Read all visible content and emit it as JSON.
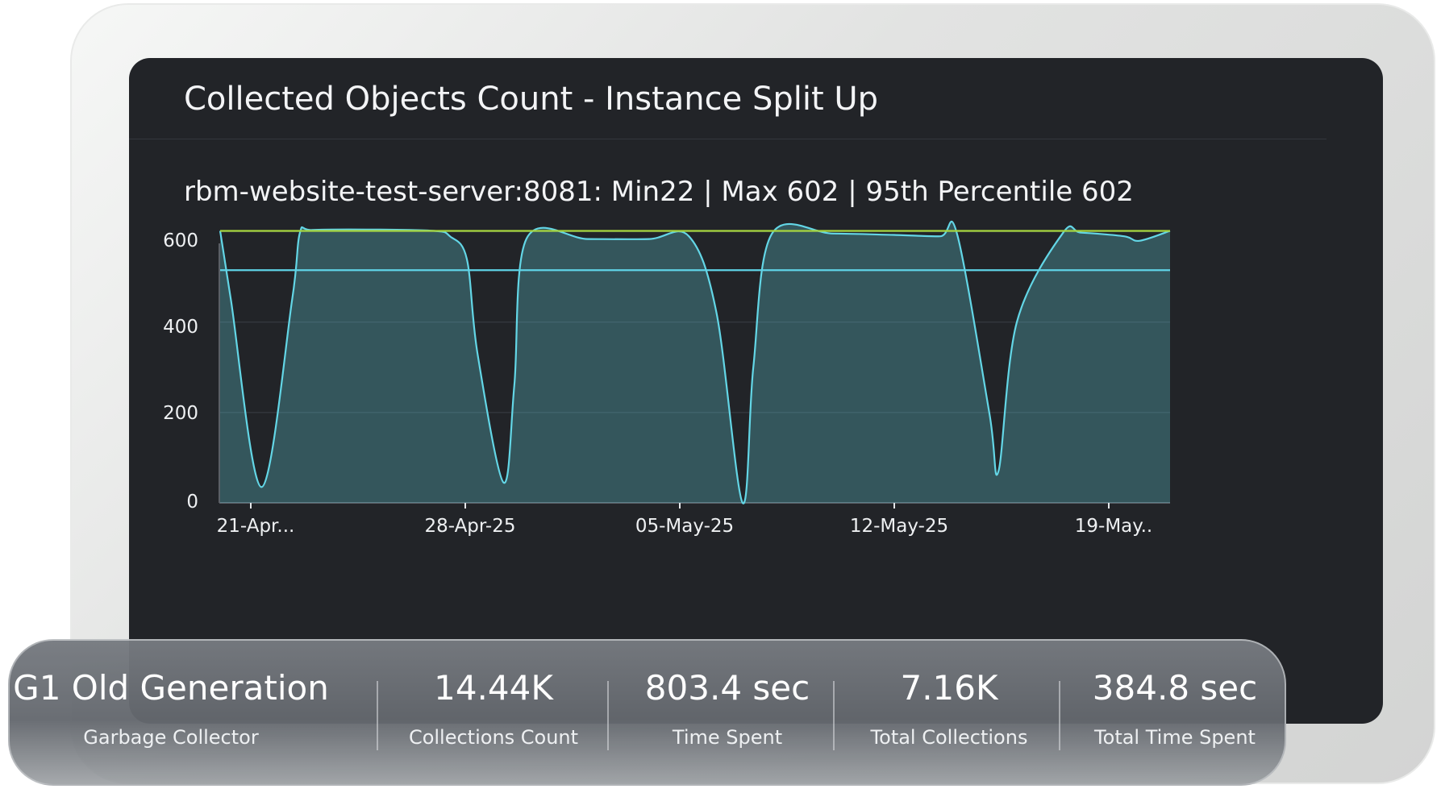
{
  "panel": {
    "title": "Collected Objects Count - Instance Split Up",
    "series_summary": "rbm-website-test-server:8081: Min22 | Max 602 | 95th Percentile 602"
  },
  "chart_data": {
    "type": "area",
    "y_ticks": [
      "600",
      "400",
      "200",
      "0"
    ],
    "x_tick_labels": [
      "21-Apr...",
      "28-Apr-25",
      "05-May-25",
      "12-May-25",
      "19-May.."
    ],
    "x_tick_days": [
      1,
      8,
      15,
      22,
      29
    ],
    "xlim_days": [
      0,
      31
    ],
    "ylim": [
      0,
      610
    ],
    "grid": true,
    "series": [
      {
        "color": "#63d6e6",
        "x_days": [
          0,
          0.35,
          1.35,
          2.35,
          2.6,
          3,
          5,
          7,
          7.5,
          8.05,
          8.4,
          9.25,
          9.6,
          10,
          12,
          14,
          15.3,
          16.2,
          17.05,
          17.4,
          18,
          20,
          22,
          23.5,
          24.05,
          25.1,
          25.4,
          26,
          27.5,
          28.1,
          29.5,
          30,
          31
        ],
        "values": [
          602,
          450,
          35,
          450,
          597,
          604,
          605,
          602,
          590,
          540,
          330,
          45,
          260,
          585,
          584,
          584,
          590,
          420,
          0,
          300,
          595,
          596,
          593,
          590,
          595,
          200,
          70,
          400,
          597,
          598,
          590,
          580,
          602
        ]
      }
    ],
    "reference_lines": [
      {
        "color": "#a5d43c",
        "value": 602
      },
      {
        "color": "#5fd3e6",
        "value": 515
      }
    ]
  },
  "stats": [
    {
      "value": "G1 Old Generation",
      "label": "Garbage Collector"
    },
    {
      "value": "14.44K",
      "label": "Collections Count"
    },
    {
      "value": "803.4 sec",
      "label": "Time Spent"
    },
    {
      "value": "7.16K",
      "label": "Total Collections"
    },
    {
      "value": "384.8 sec",
      "label": "Total Time Spent"
    }
  ]
}
